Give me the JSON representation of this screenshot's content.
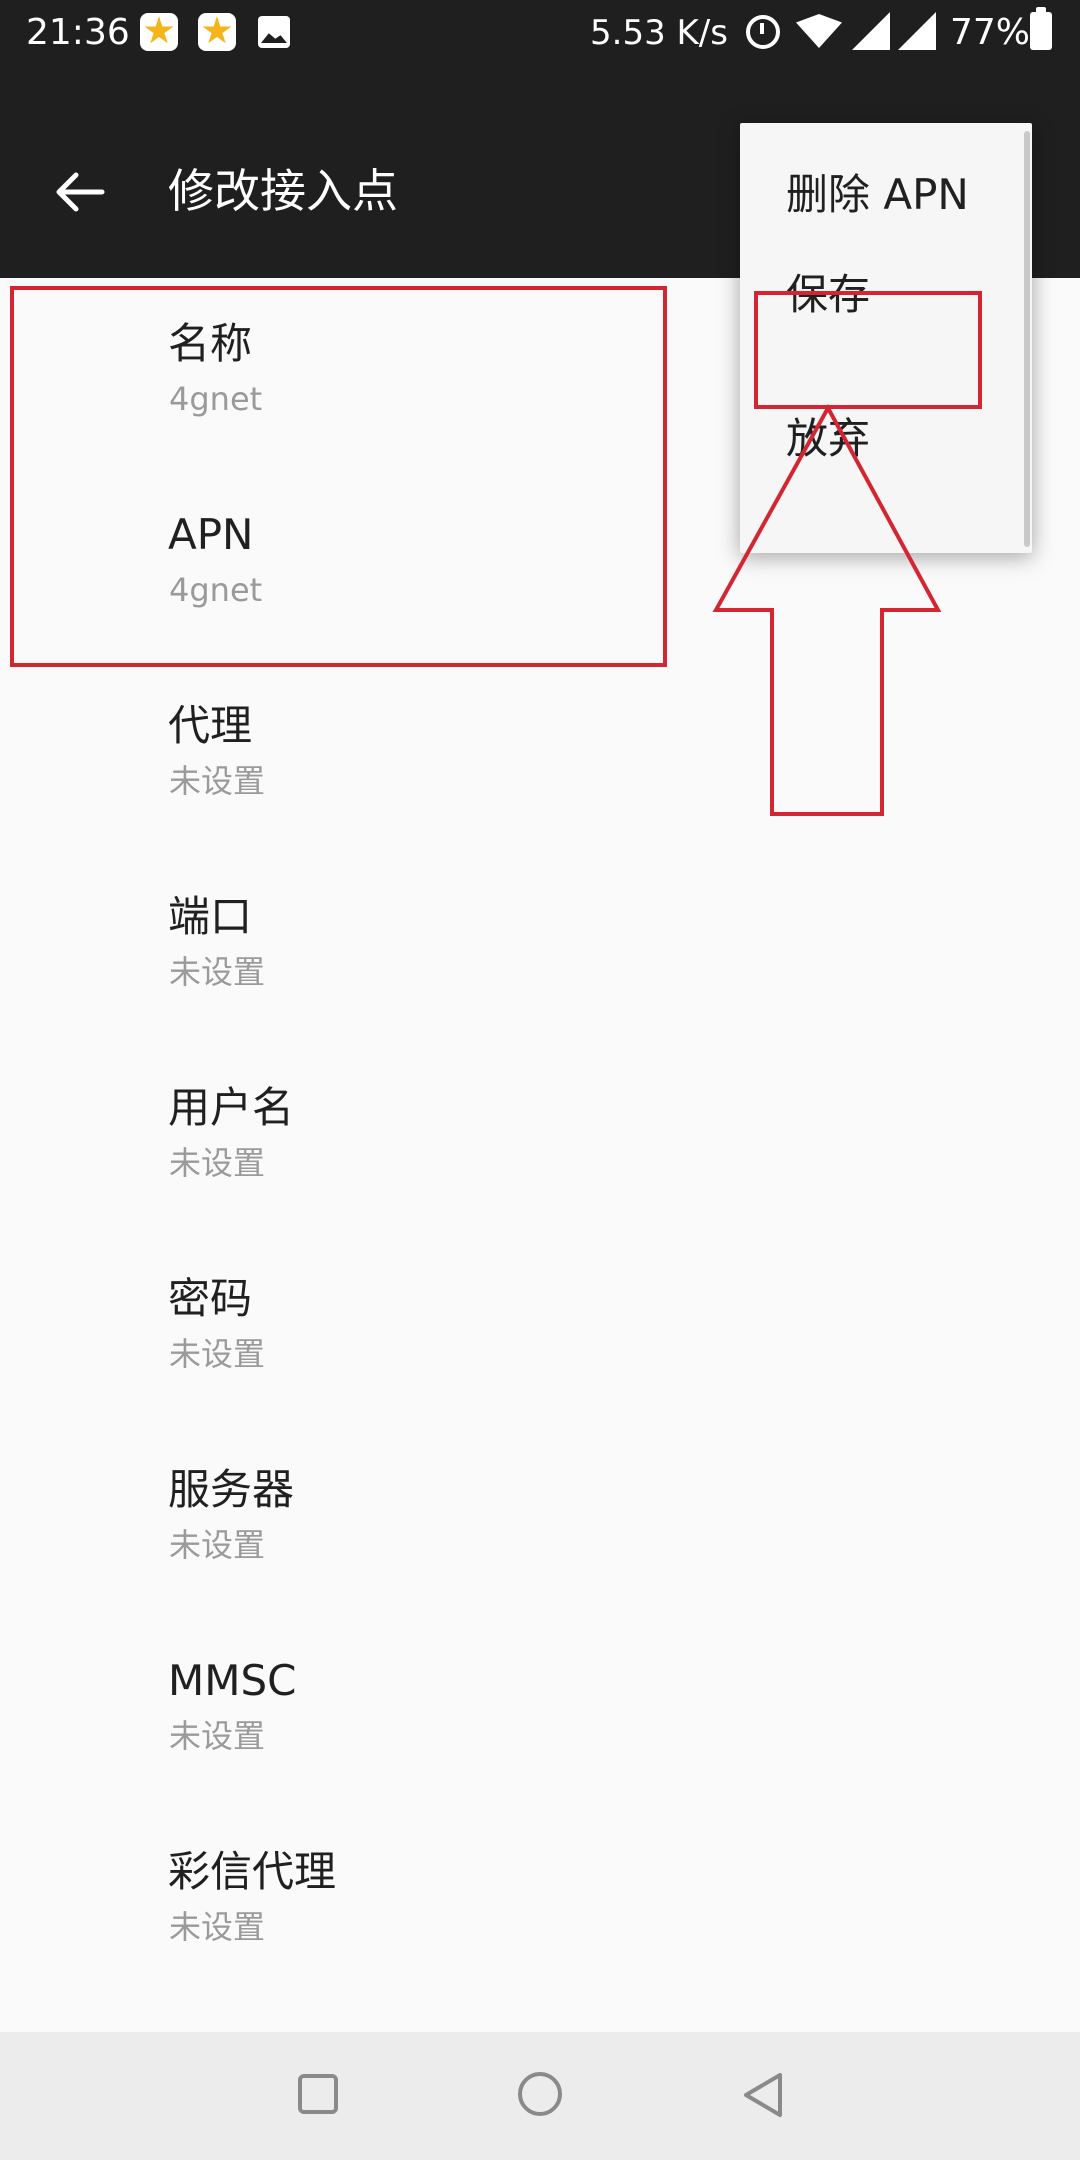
{
  "status_bar": {
    "time": "21:36",
    "network_speed": "5.53 K/s",
    "battery_percent": "77%",
    "icons": [
      "notification-app-icon",
      "notification-app-icon",
      "gallery-icon",
      "alarm-icon",
      "wifi-icon",
      "signal-icon",
      "signal-icon",
      "battery-icon"
    ]
  },
  "app_bar": {
    "title": "修改接入点",
    "back_icon": "arrow-left-icon"
  },
  "list": {
    "items": [
      {
        "title": "名称",
        "value": "4gnet"
      },
      {
        "title": "APN",
        "value": "4gnet"
      },
      {
        "title": "代理",
        "value": "未设置"
      },
      {
        "title": "端口",
        "value": "未设置"
      },
      {
        "title": "用户名",
        "value": "未设置"
      },
      {
        "title": "密码",
        "value": "未设置"
      },
      {
        "title": "服务器",
        "value": "未设置"
      },
      {
        "title": "MMSC",
        "value": "未设置"
      },
      {
        "title": "彩信代理",
        "value": "未设置"
      }
    ]
  },
  "overflow_menu": {
    "items": [
      {
        "label": "删除 APN"
      },
      {
        "label": "保存"
      },
      {
        "label": "放弃"
      }
    ]
  },
  "annotation": {
    "color": "#d32632"
  },
  "nav_bar": {
    "icons": [
      "recents-square-icon",
      "home-circle-icon",
      "back-triangle-icon"
    ]
  }
}
